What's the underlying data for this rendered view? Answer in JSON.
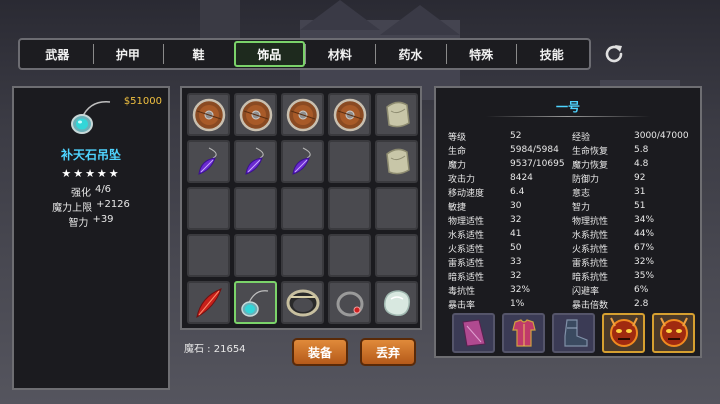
{
  "tabs": [
    {
      "label": "武器",
      "active": false
    },
    {
      "label": "护甲",
      "active": false
    },
    {
      "label": "鞋",
      "active": false
    },
    {
      "label": "饰品",
      "active": true
    },
    {
      "label": "材料",
      "active": false
    },
    {
      "label": "药水",
      "active": false
    },
    {
      "label": "特殊",
      "active": false
    },
    {
      "label": "技能",
      "active": false
    }
  ],
  "item_detail": {
    "price": "$51000",
    "name": "补天石吊坠",
    "stars": "★★★★★",
    "lines": [
      {
        "label": "强化",
        "value": "4/6"
      },
      {
        "label": "魔力上限",
        "value": "+2126"
      },
      {
        "label": "智力",
        "value": "+39"
      }
    ]
  },
  "inventory": {
    "slots": [
      {
        "icon": "shield-icon"
      },
      {
        "icon": "shield-icon"
      },
      {
        "icon": "shield-icon"
      },
      {
        "icon": "shield-icon"
      },
      {
        "icon": "cloth-icon"
      },
      {
        "icon": "purple-feather-icon"
      },
      {
        "icon": "purple-feather-icon"
      },
      {
        "icon": "purple-feather-icon"
      },
      {
        "icon": "empty"
      },
      {
        "icon": "cloth-icon"
      },
      {
        "icon": "empty"
      },
      {
        "icon": "empty"
      },
      {
        "icon": "empty"
      },
      {
        "icon": "empty"
      },
      {
        "icon": "empty"
      },
      {
        "icon": "empty"
      },
      {
        "icon": "empty"
      },
      {
        "icon": "empty"
      },
      {
        "icon": "empty"
      },
      {
        "icon": "empty"
      },
      {
        "icon": "red-feather-icon"
      },
      {
        "icon": "pendant-icon",
        "selected": true
      },
      {
        "icon": "bracelet-icon"
      },
      {
        "icon": "ring-icon"
      },
      {
        "icon": "stone-icon"
      }
    ],
    "magic_stone_label": "魔石 : 21654",
    "equip_label": "装备",
    "drop_label": "丢弃"
  },
  "character": {
    "name": "一号",
    "stats": [
      [
        "等级",
        "52",
        "经验",
        "3000/47000"
      ],
      [
        "生命",
        "5984/5984",
        "生命恢复",
        "5.8"
      ],
      [
        "魔力",
        "9537/10695",
        "魔力恢复",
        "4.8"
      ],
      [
        "攻击力",
        "8424",
        "防御力",
        "92"
      ],
      [
        "移动速度",
        "6.4",
        "意志",
        "31"
      ],
      [
        "敏捷",
        "30",
        "智力",
        "51"
      ],
      [
        "物理适性",
        "32",
        "物理抗性",
        "34%"
      ],
      [
        "水系适性",
        "41",
        "水系抗性",
        "44%"
      ],
      [
        "火系适性",
        "50",
        "火系抗性",
        "67%"
      ],
      [
        "雷系适性",
        "33",
        "雷系抗性",
        "32%"
      ],
      [
        "暗系适性",
        "32",
        "暗系抗性",
        "35%"
      ],
      [
        "毒抗性",
        "32%",
        "闪避率",
        "6%"
      ],
      [
        "暴击率",
        "1%",
        "暴击倍数",
        "2.8"
      ]
    ],
    "equipment": [
      {
        "icon": "cape-icon"
      },
      {
        "icon": "armor-icon"
      },
      {
        "icon": "boots-icon"
      },
      {
        "icon": "demon-mask-icon"
      },
      {
        "icon": "demon-mask-icon"
      }
    ]
  }
}
